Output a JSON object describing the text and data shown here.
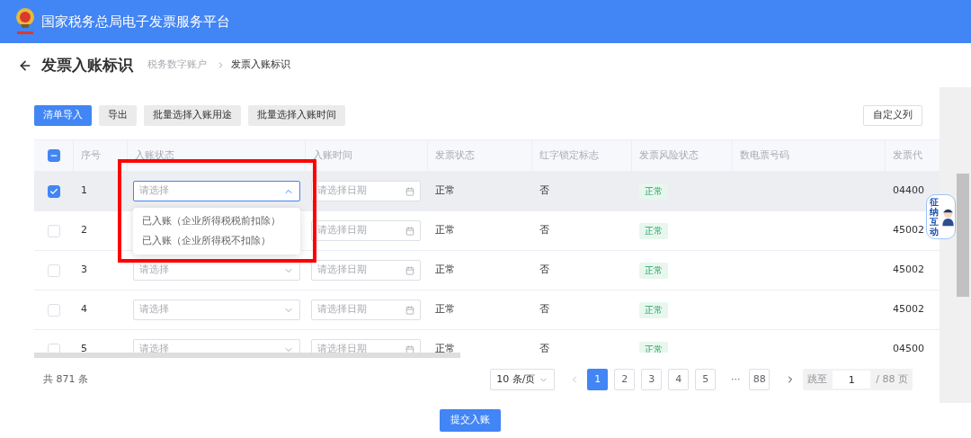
{
  "header": {
    "title": "国家税务总局电子发票服务平台"
  },
  "page": {
    "title": "发票入账标识",
    "breadcrumb": [
      {
        "label": "税务数字账户",
        "current": false
      },
      {
        "label": "发票入账标识",
        "current": true
      }
    ]
  },
  "toolbar": {
    "buttons": [
      {
        "label": "清单导入",
        "kind": "primary"
      },
      {
        "label": "导出",
        "kind": "plain"
      },
      {
        "label": "批量选择入账用途",
        "kind": "plain"
      },
      {
        "label": "批量选择入账时间",
        "kind": "plain"
      }
    ],
    "custom_columns": "自定义列"
  },
  "table": {
    "select_all_indeterminate": true,
    "columns": [
      "序号",
      "入账状态",
      "入账时间",
      "发票状态",
      "红字锁定标志",
      "发票风险状态",
      "数电票号码",
      "发票代"
    ],
    "rows": [
      {
        "selected": true,
        "index": "1",
        "status": {
          "placeholder": "请选择",
          "expanded": true,
          "options": [
            "已入账（企业所得税税前扣除）",
            "已入账（企业所得税不扣除）"
          ]
        },
        "date_placeholder": "请选择日期",
        "invoice_status": "正常",
        "red_lock": "否",
        "risk": "正常",
        "code": "04400"
      },
      {
        "selected": false,
        "index": "2",
        "date_placeholder": "请选择日期",
        "invoice_status": "正常",
        "red_lock": "否",
        "risk": "正常",
        "code": "45002"
      },
      {
        "selected": false,
        "index": "3",
        "status": {
          "placeholder": "请选择",
          "expanded": false
        },
        "date_placeholder": "请选择日期",
        "invoice_status": "正常",
        "red_lock": "否",
        "risk": "正常",
        "code": "45002"
      },
      {
        "selected": false,
        "index": "4",
        "status": {
          "placeholder": "请选择",
          "expanded": false
        },
        "date_placeholder": "请选择日期",
        "invoice_status": "正常",
        "red_lock": "否",
        "risk": "正常",
        "code": "45002"
      },
      {
        "selected": false,
        "index": "5",
        "status": {
          "placeholder": "请选择",
          "expanded": false
        },
        "date_placeholder": "请选择日期",
        "invoice_status": "正常",
        "red_lock": "否",
        "risk": "正常",
        "code": "04500"
      }
    ]
  },
  "pagination": {
    "total": "共 871 条",
    "page_size": "10 条/页",
    "prev_disabled": true,
    "next_disabled": false,
    "pages": [
      {
        "label": "1",
        "selected": true
      },
      {
        "label": "2",
        "selected": false
      },
      {
        "label": "3",
        "selected": false
      },
      {
        "label": "4",
        "selected": false
      },
      {
        "label": "5",
        "selected": false
      },
      {
        "label": "···",
        "kind": "ellipsis"
      },
      {
        "label": "88",
        "selected": false
      }
    ],
    "jump_label": "跳至",
    "jump_value": "1",
    "page_count": "/ 88 页"
  },
  "submit": "提交入账",
  "assistant": {
    "label": "征纳互动"
  }
}
